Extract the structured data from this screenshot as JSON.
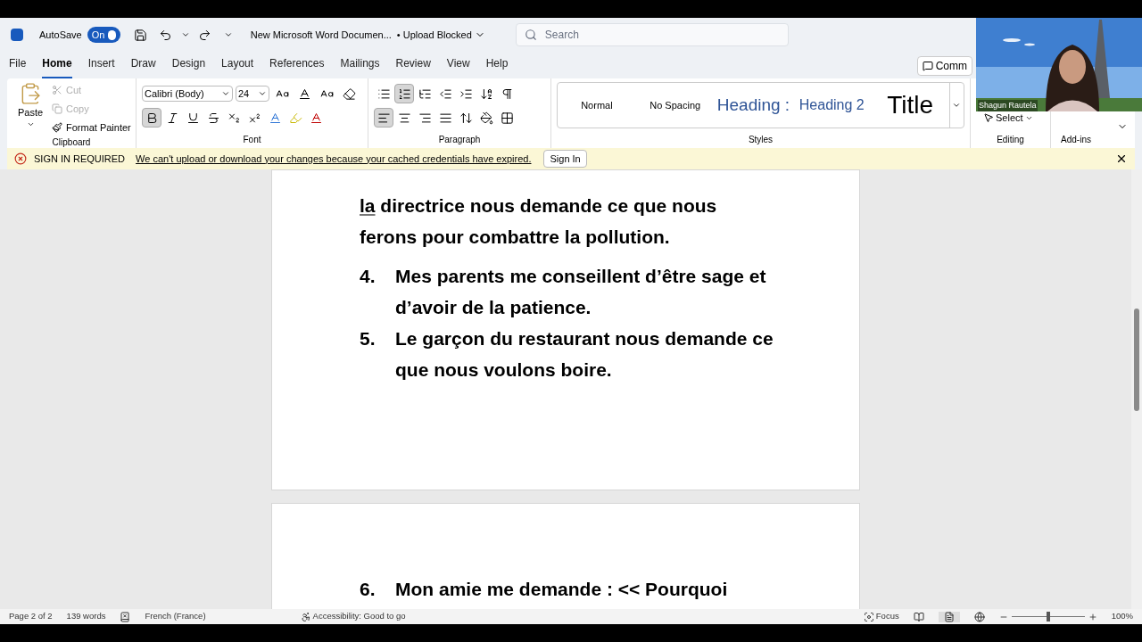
{
  "title_bar": {
    "autosave_label": "AutoSave",
    "autosave": {
      "on": true,
      "label": "On"
    },
    "document_title": "New Microsoft Word Documen...",
    "upload_status": "• Upload Blocked",
    "search": {
      "placeholder": "Search"
    }
  },
  "tabs": [
    {
      "label": "File",
      "selected": false
    },
    {
      "label": "Home",
      "selected": true
    },
    {
      "label": "Insert",
      "selected": false
    },
    {
      "label": "Draw",
      "selected": false
    },
    {
      "label": "Design",
      "selected": false
    },
    {
      "label": "Layout",
      "selected": false
    },
    {
      "label": "References",
      "selected": false
    },
    {
      "label": "Mailings",
      "selected": false
    },
    {
      "label": "Review",
      "selected": false
    },
    {
      "label": "View",
      "selected": false
    },
    {
      "label": "Help",
      "selected": false
    }
  ],
  "comments_button": "Comm",
  "ribbon": {
    "clipboard": {
      "label": "Clipboard",
      "paste": "Paste",
      "cut": {
        "label": "Cut",
        "disabled": true
      },
      "copy": {
        "label": "Copy",
        "disabled": true
      },
      "format_painter": {
        "label": "Format Painter",
        "disabled": false
      }
    },
    "font": {
      "label": "Font",
      "family": "Calibri (Body)",
      "size": "24",
      "bold": true,
      "italic": false,
      "underline": false
    },
    "paragraph": {
      "label": "Paragraph",
      "numbering": true,
      "align_left": true
    },
    "styles": {
      "label": "Styles",
      "items": [
        {
          "label": "Normal",
          "kind": "normal"
        },
        {
          "label": "No Spacing",
          "kind": "normal"
        },
        {
          "label": "Heading :",
          "kind": "heading1"
        },
        {
          "label": "Heading 2",
          "kind": "heading2"
        },
        {
          "label": "Title",
          "kind": "title"
        }
      ]
    },
    "editing": {
      "label": "Editing",
      "select": "Select"
    },
    "addins": {
      "label": "Add-ins"
    }
  },
  "message_bar": {
    "title": "SIGN IN REQUIRED",
    "message": "We can't upload or download your changes because your cached credentials have expired.",
    "button": "Sign In"
  },
  "document": {
    "paragraph": {
      "flagged_word": "la",
      "rest": " directrice nous demande ce que nous ferons pour combattre la pollution."
    },
    "items": [
      {
        "number": "4.",
        "text": "Mes parents me conseillent d’être sage et d’avoir de la patience."
      },
      {
        "number": "5.",
        "text": "Le garçon du restaurant nous demande ce que nous voulons boire."
      }
    ],
    "page_2_items": [
      {
        "number": "6.",
        "text": "Mon amie me demande : << Pourquoi"
      }
    ]
  },
  "status_bar": {
    "page": "Page 2 of 2",
    "words": "139 words",
    "language": "French (France)",
    "accessibility": "Accessibility: Good to go",
    "focus": "Focus",
    "zoom": "100%",
    "zoom_slider": {
      "level": 0.5
    }
  },
  "video": {
    "kind": "picture",
    "participant": "Shagun Rautela"
  }
}
